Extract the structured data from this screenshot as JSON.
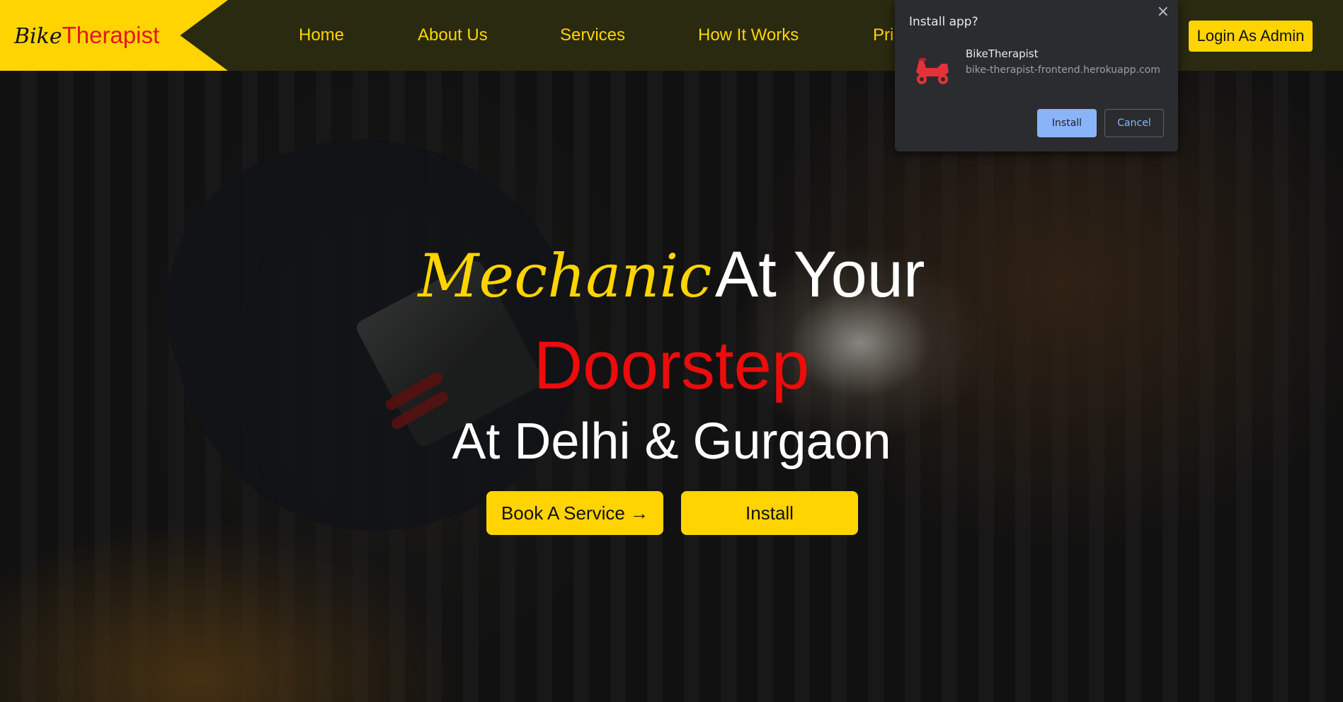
{
  "header": {
    "logo_part1": "Bike",
    "logo_part2": "Therapist",
    "nav": [
      "Home",
      "About Us",
      "Services",
      "How It Works",
      "Pri"
    ],
    "admin_label": "Login As Admin"
  },
  "hero": {
    "script_word": "Mechanic",
    "line1_rest": "At Your",
    "line2": "Doorstep",
    "line3": "At Delhi & Gurgaon",
    "book_label": "Book A Service →",
    "install_label": "Install"
  },
  "install_prompt": {
    "title": "Install app?",
    "app_name": "BikeTherapist",
    "url": "bike-therapist-frontend.herokuapp.com",
    "install_label": "Install",
    "cancel_label": "Cancel",
    "close_icon": "×",
    "icon_name": "scooter-icon"
  },
  "colors": {
    "brand_yellow": "#ffd400",
    "brand_red": "#ee0b0b",
    "nav_bg": "#2a2a10",
    "dialog_bg": "#2b2c30",
    "dialog_accent": "#8ab4f8"
  }
}
